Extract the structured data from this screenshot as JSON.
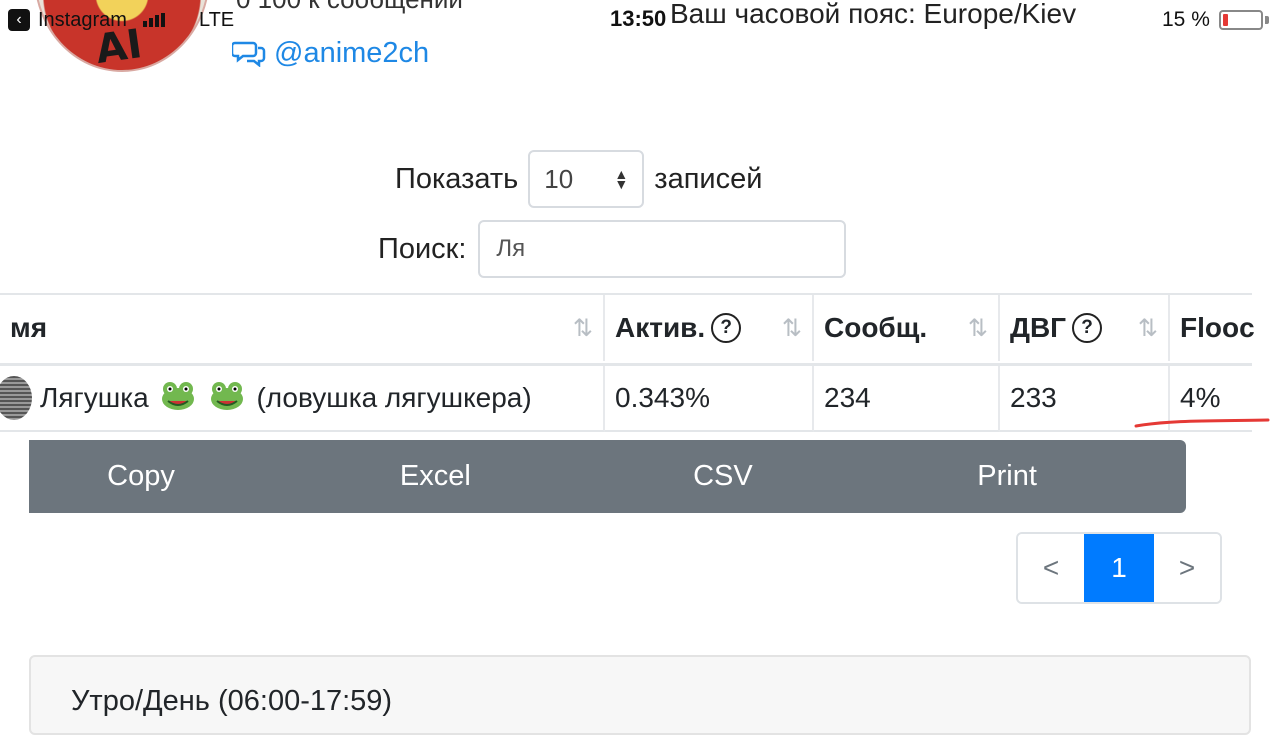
{
  "status_bar": {
    "back_app": "Instagram",
    "network": "LTE",
    "time": "13:50",
    "timezone_text": "Ваш часовой пояс: Europe/Kiev",
    "battery_percent_text": "15 %",
    "battery_level": 0.15,
    "cut_header_text": "0 100 к сообщений"
  },
  "profile": {
    "logo_text": "AI",
    "channel_handle": "@anime2ch"
  },
  "controls": {
    "show_label": "Показать",
    "show_value": "10",
    "show_suffix": "записей",
    "search_label": "Поиск:",
    "search_value": "Ля"
  },
  "table": {
    "columns": [
      {
        "label": "мя",
        "help": false
      },
      {
        "label": "Актив.",
        "help": true
      },
      {
        "label": "Сообщ.",
        "help": false
      },
      {
        "label": "ДВГ",
        "help": true
      },
      {
        "label": "Flooc",
        "help": false
      }
    ],
    "rows": [
      {
        "name_prefix": "Лягушка",
        "emoji": "🐸🐸",
        "name_suffix": "(ловушка лягушкера)",
        "activity": "0.343%",
        "messages": "234",
        "dvg": "233",
        "flood": "4%"
      }
    ]
  },
  "export_buttons": [
    "Copy",
    "Excel",
    "CSV",
    "Print"
  ],
  "pagination": {
    "prev": "<",
    "current": "1",
    "next": ">"
  },
  "section": {
    "title": "Утро/День (06:00-17:59)"
  },
  "colors": {
    "link_blue": "#1e88e5",
    "button_gray": "#6c757d",
    "active_page": "#007bff",
    "annotation_red": "#e53935"
  }
}
